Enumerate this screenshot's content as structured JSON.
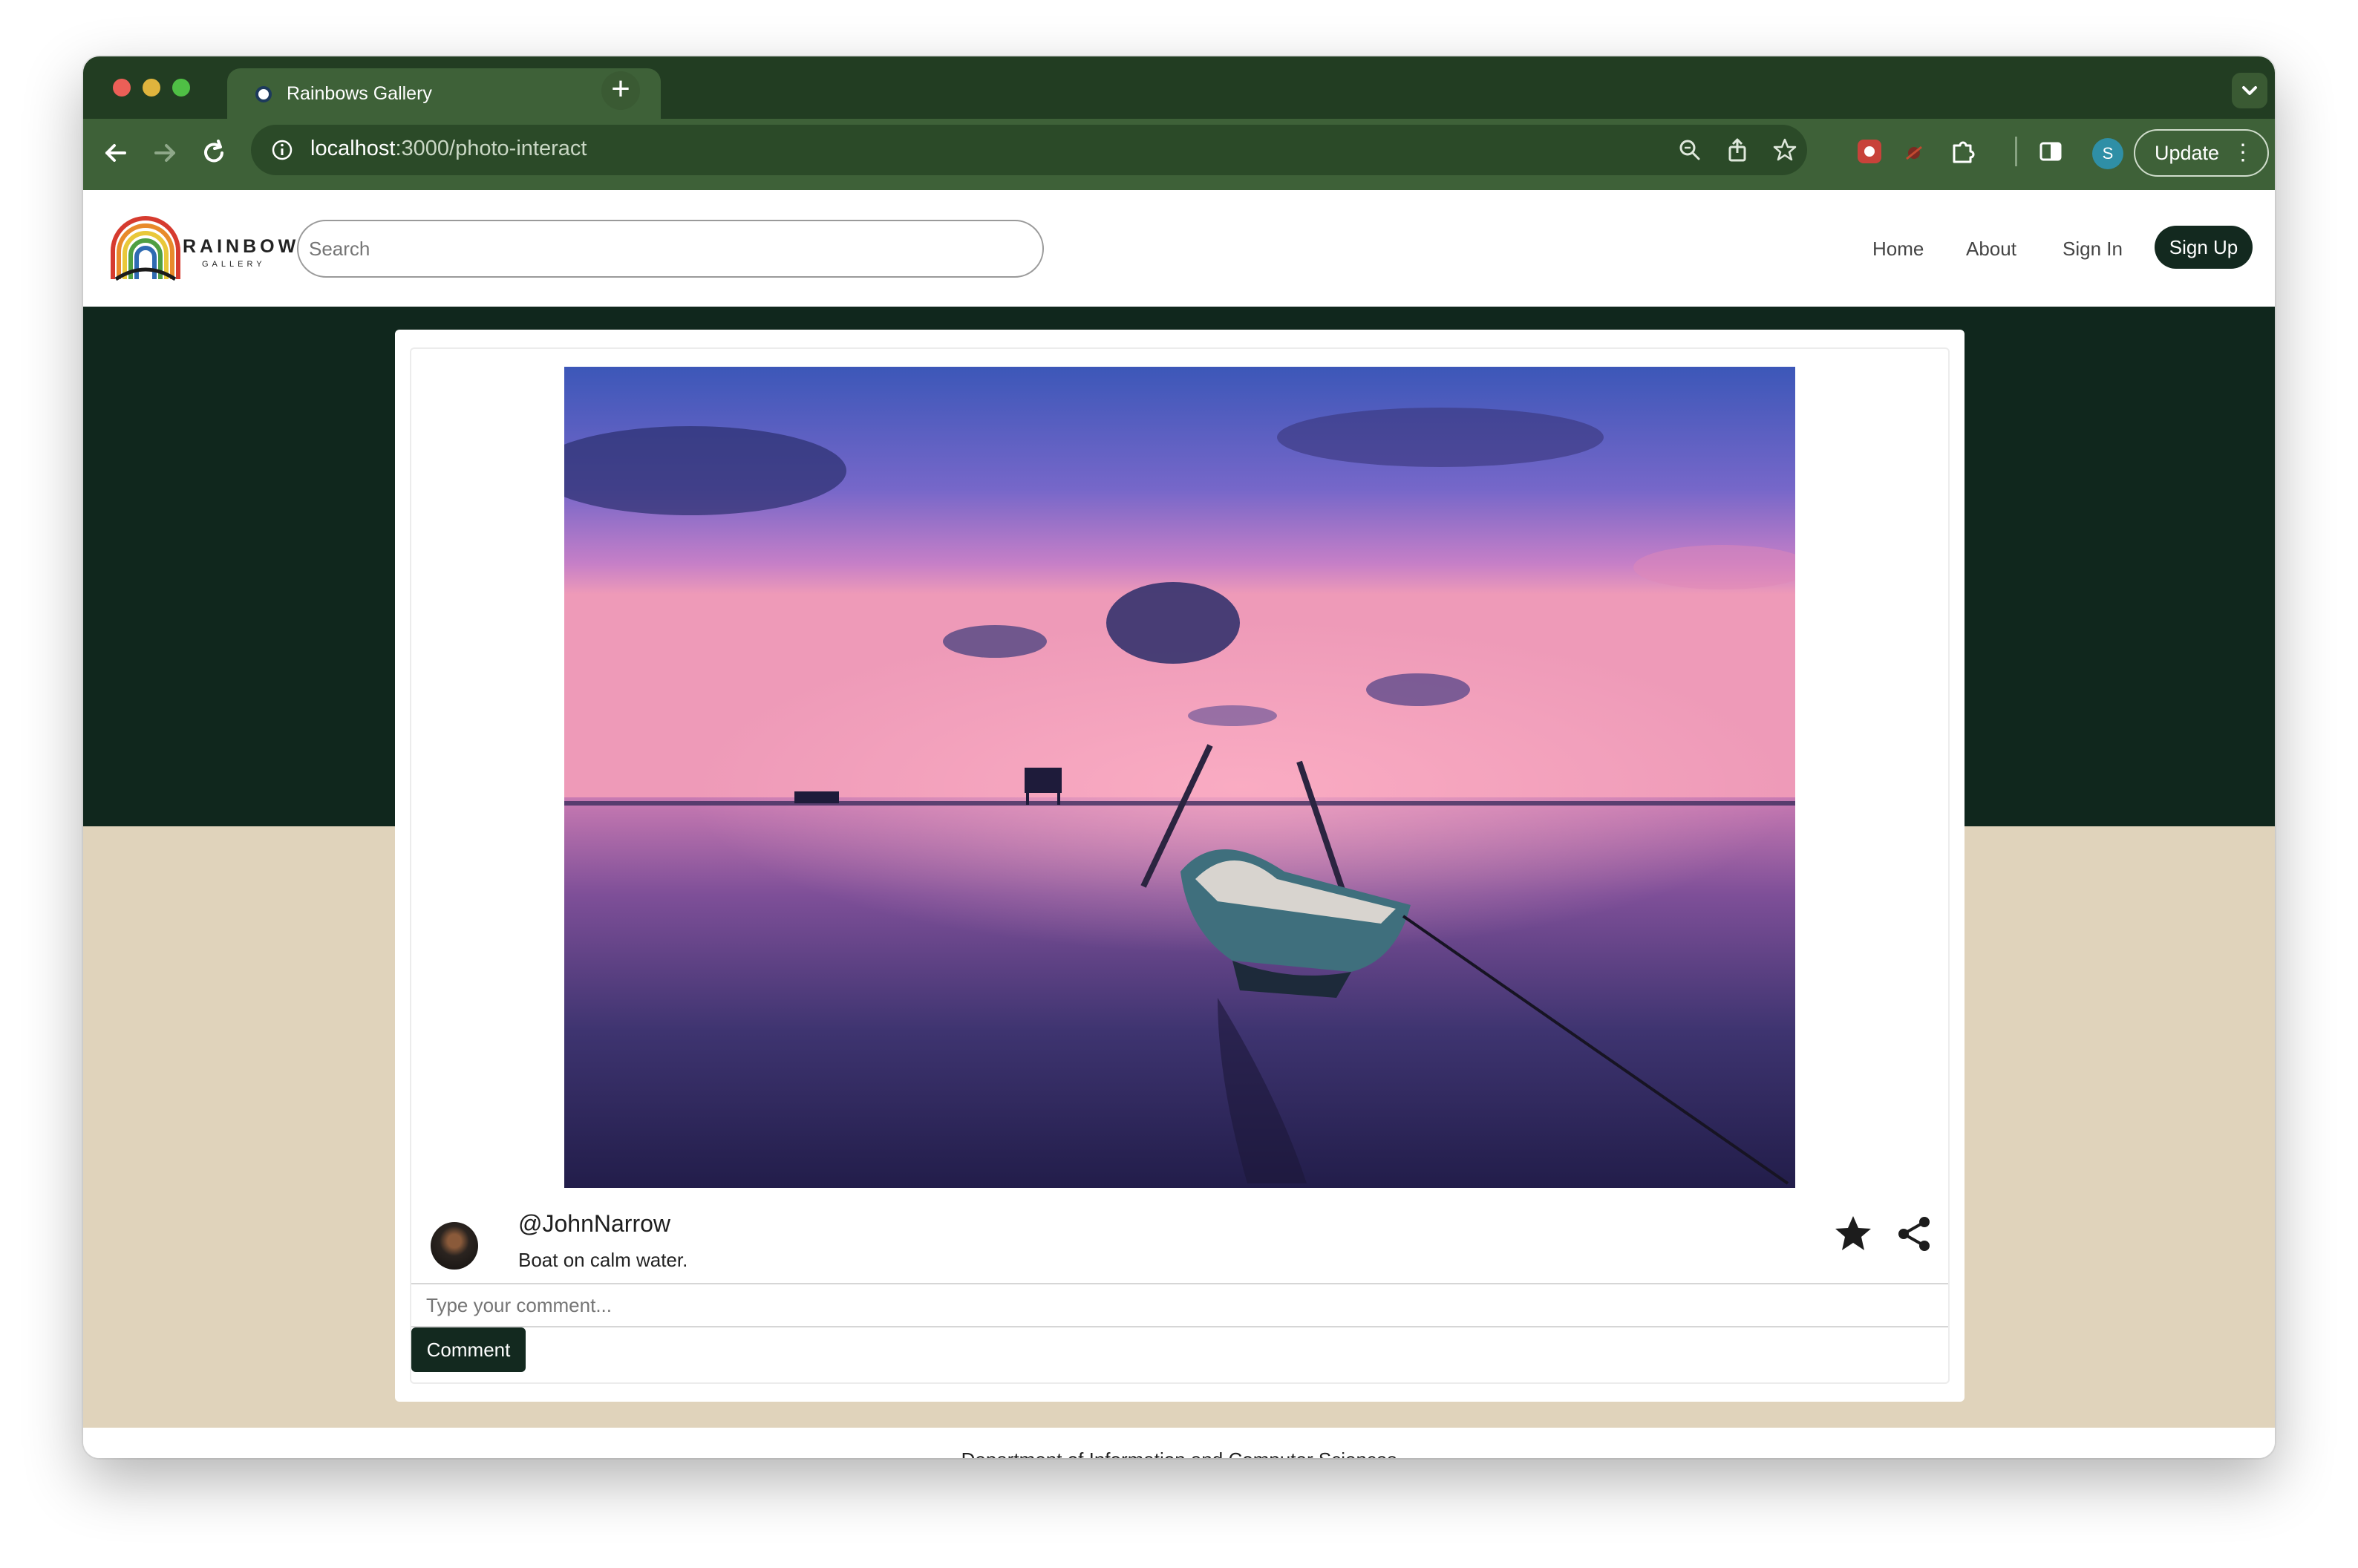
{
  "browser": {
    "tab_title": "Rainbows Gallery",
    "tab_close": "×",
    "new_tab": "+",
    "url_host": "localhost",
    "url_path": ":3000/photo-interact",
    "profile_initial": "S",
    "update_label": "Update",
    "menu_glyph": "⋮"
  },
  "site": {
    "logo_word": "RAINBOW",
    "logo_sub": "GALLERY",
    "search_placeholder": "Search",
    "nav": {
      "home": "Home",
      "about": "About",
      "sign_in": "Sign In",
      "sign_up": "Sign Up"
    },
    "colors": {
      "primary_dark": "#13291f",
      "band_dark": "#10271d",
      "band_tan": "#e0d3bb"
    }
  },
  "post": {
    "username": "@JohnNarrow",
    "caption": "Boat on calm water.",
    "comment_placeholder": "Type your comment...",
    "comment_button": "Comment"
  },
  "footer": {
    "text": "Department of Information and Computer Sciences"
  },
  "icons": [
    "back-icon",
    "forward-icon",
    "reload-icon",
    "info-icon",
    "zoom-icon",
    "share-page-icon",
    "bookmark-star-icon",
    "extension-icon",
    "puzzle-icon",
    "sidebar-icon",
    "favorite-star-icon",
    "share-icon"
  ]
}
